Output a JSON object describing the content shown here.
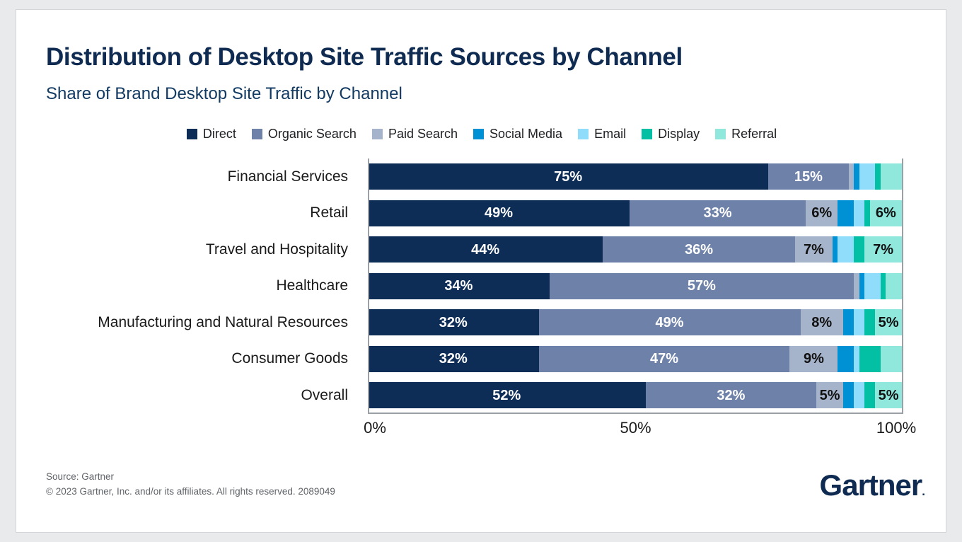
{
  "header": {
    "title": "Distribution of Desktop Site Traffic Sources by Channel",
    "subtitle": "Share of Brand Desktop Site Traffic by Channel"
  },
  "footer": {
    "source": "Source: Gartner",
    "copyright": "© 2023 Gartner, Inc. and/or its affiliates. All rights reserved. 2089049",
    "logo_text": "Gartner",
    "logo_mark": "."
  },
  "colors": {
    "direct": "#0d2d57",
    "organic_search": "#6e81a8",
    "paid_search": "#a6b4cb",
    "social_media": "#0091d5",
    "email": "#8fdcfb",
    "display": "#03bfa4",
    "referral": "#90e8dc",
    "title": "#0f2b52",
    "subtitle": "#123a63",
    "axis": "#9aa0a6",
    "footer_text": "#5f6368",
    "page_background": "#e9eaec",
    "card_background": "#ffffff"
  },
  "chart_data": {
    "type": "bar",
    "orientation": "horizontal",
    "stacked": true,
    "stacked_mode": "percent",
    "title": "Distribution of Desktop Site Traffic Sources by Channel",
    "subtitle": "Share of Brand Desktop Site Traffic by Channel",
    "xlabel": "",
    "ylabel": "",
    "xlim": [
      0,
      100
    ],
    "xticks": [
      "0%",
      "50%",
      "100%"
    ],
    "xtick_values": [
      0,
      50,
      100
    ],
    "grid": false,
    "legend_position": "top-center",
    "categories": [
      "Financial Services",
      "Retail",
      "Travel and Hospitality",
      "Healthcare",
      "Manufacturing and Natural Resources",
      "Consumer Goods",
      "Overall"
    ],
    "series": [
      {
        "name": "Direct",
        "color": "#0d2d57",
        "values": [
          75,
          49,
          44,
          34,
          32,
          32,
          52
        ],
        "labels": [
          "75%",
          "49%",
          "44%",
          "34%",
          "32%",
          "32%",
          "52%"
        ]
      },
      {
        "name": "Organic Search",
        "color": "#6e81a8",
        "values": [
          15,
          33,
          36,
          57,
          49,
          47,
          32
        ],
        "labels": [
          "15%",
          "33%",
          "36%",
          "57%",
          "49%",
          "47%",
          "32%"
        ]
      },
      {
        "name": "Paid Search",
        "color": "#a6b4cb",
        "values": [
          1,
          6,
          7,
          1,
          8,
          9,
          5
        ],
        "labels": [
          "",
          "6%",
          "7%",
          "",
          "8%",
          "9%",
          "5%"
        ]
      },
      {
        "name": "Social Media",
        "color": "#0091d5",
        "values": [
          1,
          3,
          1,
          1,
          2,
          3,
          2
        ],
        "labels": [
          "",
          "",
          "",
          "",
          "",
          "",
          ""
        ]
      },
      {
        "name": "Email",
        "color": "#8fdcfb",
        "values": [
          3,
          2,
          3,
          3,
          2,
          1,
          2
        ],
        "labels": [
          "",
          "",
          "",
          "",
          "",
          "",
          ""
        ]
      },
      {
        "name": "Display",
        "color": "#03bfa4",
        "values": [
          1,
          1,
          2,
          1,
          2,
          4,
          2
        ],
        "labels": [
          "",
          "",
          "",
          "",
          "",
          "",
          ""
        ]
      },
      {
        "name": "Referral",
        "color": "#90e8dc",
        "values": [
          4,
          6,
          7,
          3,
          5,
          4,
          5
        ],
        "labels": [
          "",
          "6%",
          "7%",
          "",
          "5%",
          "",
          "5%"
        ]
      }
    ]
  }
}
